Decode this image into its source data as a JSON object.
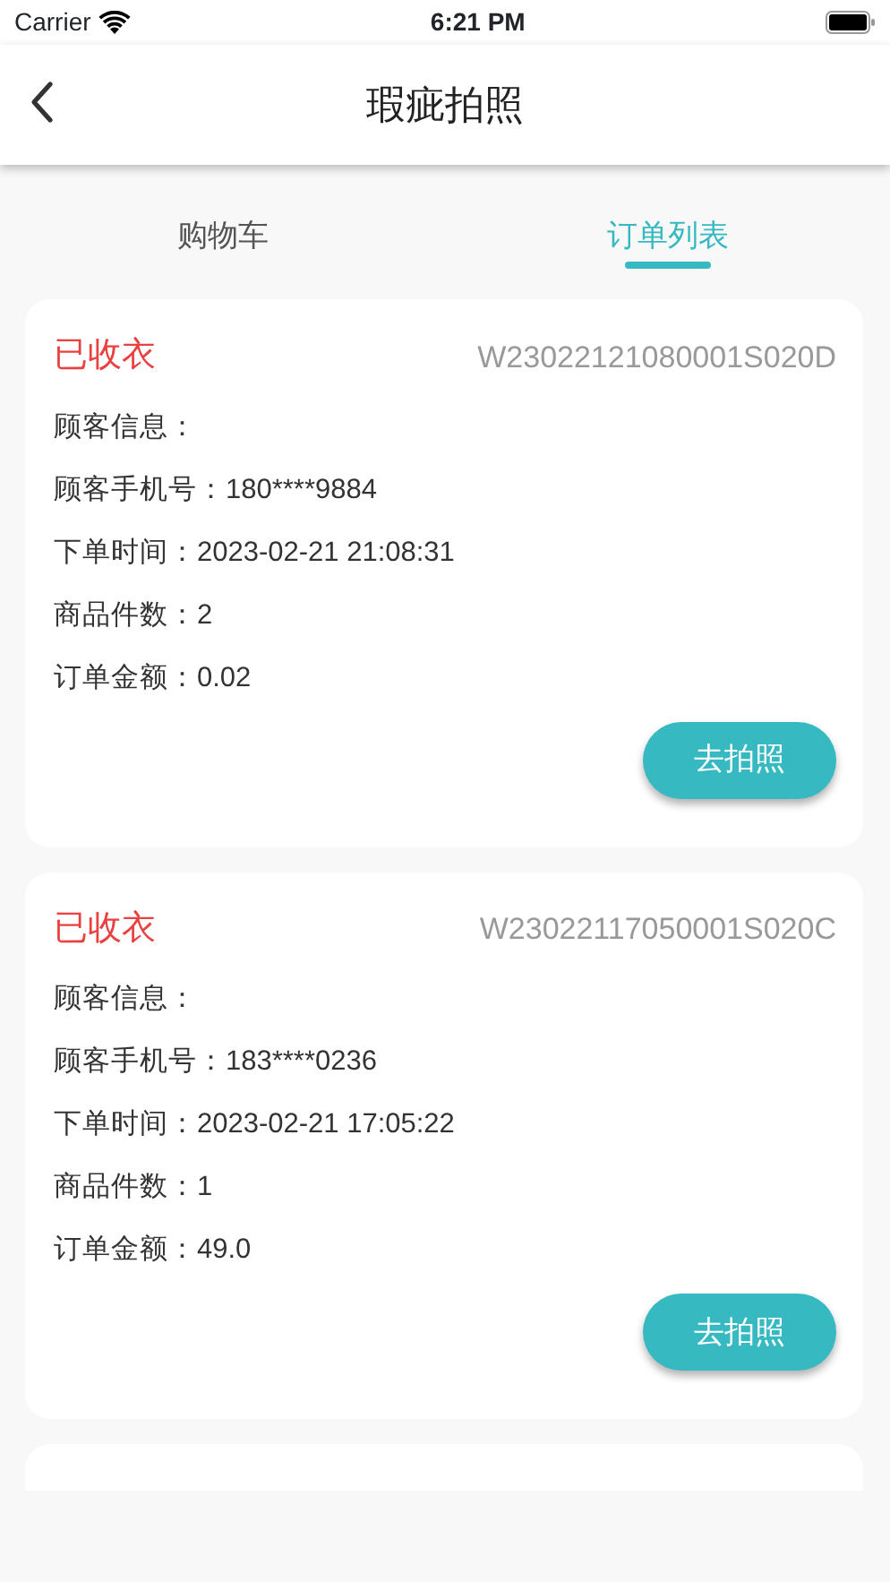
{
  "status_bar": {
    "carrier": "Carrier",
    "time": "6:21 PM"
  },
  "nav_bar": {
    "title": "瑕疵拍照"
  },
  "tabs": [
    {
      "label": "购物车",
      "selected": false
    },
    {
      "label": "订单列表",
      "selected": true
    }
  ],
  "orders": [
    {
      "status": "已收衣",
      "order_no": "W23022121080001S020D",
      "fields": [
        {
          "label": "顾客信息："
        },
        {
          "label": "顾客手机号：",
          "value": "180****9884"
        },
        {
          "label": "下单时间：",
          "value": "2023-02-21 21:08:31"
        },
        {
          "label": "商品件数：",
          "value": "2"
        },
        {
          "label": "订单金额：",
          "value": "0.02"
        }
      ],
      "button": "去拍照"
    },
    {
      "status": "已收衣",
      "order_no": "W23022117050001S020C",
      "fields": [
        {
          "label": "顾客信息："
        },
        {
          "label": "顾客手机号：",
          "value": "183****0236"
        },
        {
          "label": "下单时间：",
          "value": "2023-02-21 17:05:22"
        },
        {
          "label": "商品件数：",
          "value": "1"
        },
        {
          "label": "订单金额：",
          "value": "49.0"
        }
      ],
      "button": "去拍照"
    }
  ]
}
